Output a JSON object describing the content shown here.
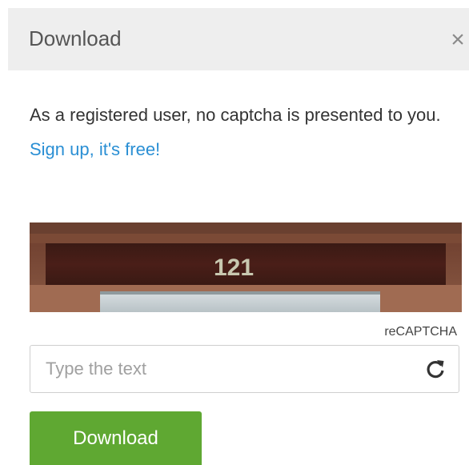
{
  "dialog": {
    "title": "Download",
    "close_icon": "close-icon",
    "close_glyph": "×"
  },
  "message": {
    "text": "As a registered user, no captcha is presented to you.",
    "link_text": "Sign up, it's free!",
    "link_color": "#2a8fd4"
  },
  "captcha": {
    "image_text": "121",
    "brand": "reCAPTCHA",
    "input_placeholder": "Type the text",
    "input_value": "",
    "reload_icon": "reload-icon"
  },
  "actions": {
    "download_label": "Download",
    "download_color": "#5fa832"
  }
}
